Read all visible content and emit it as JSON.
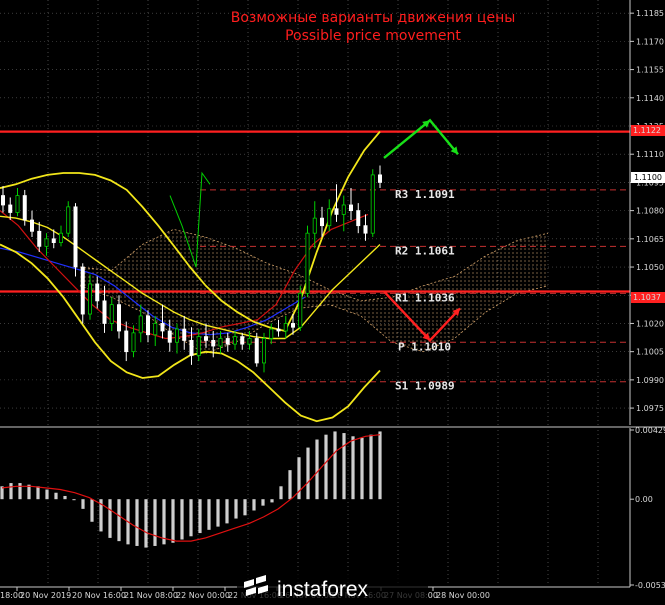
{
  "header": {
    "title_ru": "Возможные варианты движения цены",
    "title_en": "Possible price movement"
  },
  "watermark": {
    "text": "instaforex"
  },
  "colors": {
    "background": "#000000",
    "bull": "#00d000",
    "bear": "#ffffff",
    "bollinger": "#f2e61a",
    "ma_red": "#d01010",
    "ma_blue": "#2030ff",
    "kumo": "#d4a36a",
    "levels": "#ff2020",
    "arrow_up": "#18e018",
    "arrow_down": "#ff2020",
    "macd": "#cfcfcf",
    "signal": "#e01010"
  },
  "chart_data": [
    {
      "type": "candlestick",
      "price_axis": {
        "ylim": [
          1.0966,
          1.1192
        ],
        "ticks": [
          "1.1185",
          "1.1170",
          "1.1155",
          "1.1140",
          "1.1125",
          "1.1110",
          "1.1095",
          "1.1080",
          "1.1065",
          "1.1050",
          "1.1035",
          "1.1020",
          "1.1005",
          "1.0990",
          "1.0975"
        ],
        "price_tag": "1.1100",
        "red_level_tags": [
          "1.1122",
          "1.1037"
        ]
      },
      "time_axis": {
        "labels": [
          "20 Nov 2019",
          "20 Nov 16:00",
          "21 Nov 08:00",
          "22 Nov 00:00",
          "22 Nov 16:00",
          "26 Nov 00:00",
          "26 Nov 16:00",
          "27 Nov 08:00",
          "28 Nov 00:00"
        ],
        "start_label": "18:00"
      },
      "levels": [
        {
          "name": "R3",
          "value": "1.1091",
          "label": "R3  1.1091"
        },
        {
          "name": "R2",
          "value": "1.1061",
          "label": "R2  1.1061"
        },
        {
          "name": "R1",
          "value": "1.1036",
          "label": "R1  1.1036"
        },
        {
          "name": "P",
          "value": "1.1010",
          "label": "P  1.1010"
        },
        {
          "name": "S1",
          "value": "1.0989",
          "label": "S1  1.0989"
        }
      ],
      "horizontal_lines": [
        1.1122,
        1.1037
      ],
      "candles": [
        [
          1.1088,
          1.1093,
          1.1079,
          1.1083
        ],
        [
          1.1083,
          1.1087,
          1.1075,
          1.1079
        ],
        [
          1.1079,
          1.1092,
          1.1077,
          1.1088
        ],
        [
          1.1088,
          1.1091,
          1.1072,
          1.1075
        ],
        [
          1.1075,
          1.108,
          1.1066,
          1.1069
        ],
        [
          1.1069,
          1.1074,
          1.1058,
          1.1061
        ],
        [
          1.1061,
          1.1068,
          1.1056,
          1.1065
        ],
        [
          1.1065,
          1.107,
          1.106,
          1.1063
        ],
        [
          1.1063,
          1.1072,
          1.1061,
          1.1068
        ],
        [
          1.1068,
          1.1085,
          1.1066,
          1.1082
        ],
        [
          1.1082,
          1.1084,
          1.1045,
          1.105
        ],
        [
          1.105,
          1.1052,
          1.102,
          1.1025
        ],
        [
          1.1025,
          1.1046,
          1.1022,
          1.1041
        ],
        [
          1.1041,
          1.1045,
          1.1028,
          1.1032
        ],
        [
          1.1032,
          1.104,
          1.1015,
          1.102
        ],
        [
          1.102,
          1.1034,
          1.1016,
          1.103
        ],
        [
          1.103,
          1.1035,
          1.1012,
          1.1016
        ],
        [
          1.1016,
          1.1021,
          1.1,
          1.1005
        ],
        [
          1.1005,
          1.1019,
          1.1002,
          1.1015
        ],
        [
          1.1015,
          1.103,
          1.101,
          1.1024
        ],
        [
          1.1024,
          1.1027,
          1.101,
          1.1014
        ],
        [
          1.1014,
          1.1024,
          1.1008,
          1.102
        ],
        [
          1.102,
          1.103,
          1.1012,
          1.1016
        ],
        [
          1.1016,
          1.1022,
          1.1005,
          1.101
        ],
        [
          1.101,
          1.102,
          1.1004,
          1.1017
        ],
        [
          1.1017,
          1.1024,
          1.1006,
          1.1011
        ],
        [
          1.1011,
          1.1018,
          1.0998,
          1.1003
        ],
        [
          1.1003,
          1.1017,
          1.1,
          1.1013
        ],
        [
          1.1013,
          1.102,
          1.1007,
          1.1011
        ],
        [
          1.1011,
          1.1016,
          1.1002,
          1.1008
        ],
        [
          1.1008,
          1.1016,
          1.1004,
          1.1012
        ],
        [
          1.1012,
          1.1015,
          1.1005,
          1.1009
        ],
        [
          1.1009,
          1.1016,
          1.1006,
          1.1013
        ],
        [
          1.1013,
          1.1015,
          1.1006,
          1.1009
        ],
        [
          1.1009,
          1.1016,
          1.1006,
          1.1012
        ],
        [
          1.1012,
          1.1015,
          1.0997,
          1.0999
        ],
        [
          1.0999,
          1.1015,
          1.0994,
          1.1012
        ],
        [
          1.1012,
          1.102,
          1.1009,
          1.1017
        ],
        [
          1.1017,
          1.1022,
          1.1013,
          1.1016
        ],
        [
          1.1016,
          1.1024,
          1.1012,
          1.102
        ],
        [
          1.102,
          1.1025,
          1.1014,
          1.1018
        ],
        [
          1.1018,
          1.104,
          1.1016,
          1.1036
        ],
        [
          1.1036,
          1.1072,
          1.1034,
          1.1068
        ],
        [
          1.1068,
          1.1085,
          1.106,
          1.1076
        ],
        [
          1.1076,
          1.1082,
          1.1066,
          1.1072
        ],
        [
          1.1072,
          1.1086,
          1.1069,
          1.1081
        ],
        [
          1.1081,
          1.1094,
          1.1074,
          1.1078
        ],
        [
          1.1078,
          1.1088,
          1.1069,
          1.1083
        ],
        [
          1.1083,
          1.1092,
          1.1075,
          1.108
        ],
        [
          1.108,
          1.1084,
          1.1068,
          1.1072
        ],
        [
          1.1072,
          1.1078,
          1.1064,
          1.1068
        ],
        [
          1.1068,
          1.1102,
          1.1066,
          1.1099
        ],
        [
          1.1099,
          1.1104,
          1.1092,
          1.1095
        ]
      ],
      "bollinger_upper": [
        1.1092,
        1.1094,
        1.1097,
        1.1099,
        1.11,
        1.11,
        1.1099,
        1.1096,
        1.1091,
        1.1082,
        1.1072,
        1.1061,
        1.105,
        1.104,
        1.1032,
        1.1026,
        1.1021,
        1.1018,
        1.1016,
        1.1033,
        1.1058,
        1.108,
        1.1098,
        1.1112,
        1.1122
      ],
      "bollinger_lower": [
        1.1062,
        1.1058,
        1.1052,
        1.1044,
        1.1034,
        1.1022,
        1.101,
        1.1,
        1.0994,
        1.0991,
        1.0992,
        1.0998,
        1.1003,
        1.1005,
        1.1004,
        1.1,
        1.0994,
        1.0986,
        1.0978,
        1.0971,
        1.0968,
        1.097,
        1.0976,
        1.0986,
        1.0995
      ],
      "bollinger_mid": [
        1.1077,
        1.1076,
        1.1074,
        1.1071,
        1.1066,
        1.106,
        1.1054,
        1.1048,
        1.1042,
        1.1036,
        1.1031,
        1.1026,
        1.1022,
        1.1019,
        1.1017,
        1.1015,
        1.1013,
        1.1012,
        1.1012,
        1.1018,
        1.1028,
        1.1038,
        1.1046,
        1.1054,
        1.1062
      ],
      "ma_red": [
        1.108,
        1.1072,
        1.106,
        1.105,
        1.104,
        1.103,
        1.1022,
        1.1018,
        1.1015,
        1.1012,
        1.1013,
        1.1015,
        1.1018,
        1.102,
        1.1022,
        1.103,
        1.1048,
        1.1062,
        1.107,
        1.1074,
        1.1078
      ],
      "ma_blue": [
        1.106,
        1.1058,
        1.1055,
        1.1052,
        1.1049,
        1.1046,
        1.104,
        1.1032,
        1.1024,
        1.1018,
        1.1015,
        1.1014,
        1.1015,
        1.1018,
        1.1022,
        1.1028,
        1.1034
      ],
      "kumo_upper": [
        1.105,
        1.1048,
        1.1062,
        1.107,
        1.1066,
        1.106,
        1.1052,
        1.1046,
        1.1038,
        1.1032,
        1.1034,
        1.104,
        1.1045,
        1.1056,
        1.1064,
        1.1068
      ],
      "kumo_lower": [
        1.104,
        1.1034,
        1.1026,
        1.1014,
        1.1004,
        1.101,
        1.102,
        1.1028,
        1.103,
        1.1024,
        1.101,
        1.1005,
        1.1012,
        1.1026,
        1.1036,
        1.104
      ],
      "arrow_up": [
        [
          1.1108,
          1.1128
        ],
        [
          1.1128,
          1.111
        ]
      ],
      "arrow_down": [
        [
          1.1037,
          1.1011
        ],
        [
          1.1011,
          1.1028
        ]
      ]
    },
    {
      "type": "bar",
      "panel": "oscillator",
      "ylim": [
        -0.00532,
        0.00429
      ],
      "ticks": [
        "0.00429",
        "0.00",
        "-0.00532"
      ],
      "values": [
        0.0008,
        0.001,
        0.001,
        0.0009,
        0.0008,
        0.0006,
        0.0004,
        0.0002,
        0.0,
        -0.0006,
        -0.0014,
        -0.002,
        -0.0024,
        -0.0026,
        -0.0028,
        -0.0029,
        -0.003,
        -0.0029,
        -0.0028,
        -0.0027,
        -0.0025,
        -0.0023,
        -0.0021,
        -0.0019,
        -0.0017,
        -0.0015,
        -0.0012,
        -0.001,
        -0.0007,
        -0.0004,
        -0.0002,
        0.0008,
        0.0018,
        0.0026,
        0.0032,
        0.0037,
        0.004,
        0.0042,
        0.0041,
        0.0039,
        0.0038,
        0.004,
        0.0042
      ],
      "signal": [
        0.0007,
        0.0008,
        0.0008,
        0.0007,
        0.0006,
        0.0004,
        0.0001,
        -0.0004,
        -0.001,
        -0.0016,
        -0.0021,
        -0.0024,
        -0.0026,
        -0.0026,
        -0.0024,
        -0.0021,
        -0.0018,
        -0.0015,
        -0.0011,
        -0.0006,
        0.0001,
        0.001,
        0.002,
        0.003,
        0.0036,
        0.0039,
        0.004
      ]
    }
  ]
}
